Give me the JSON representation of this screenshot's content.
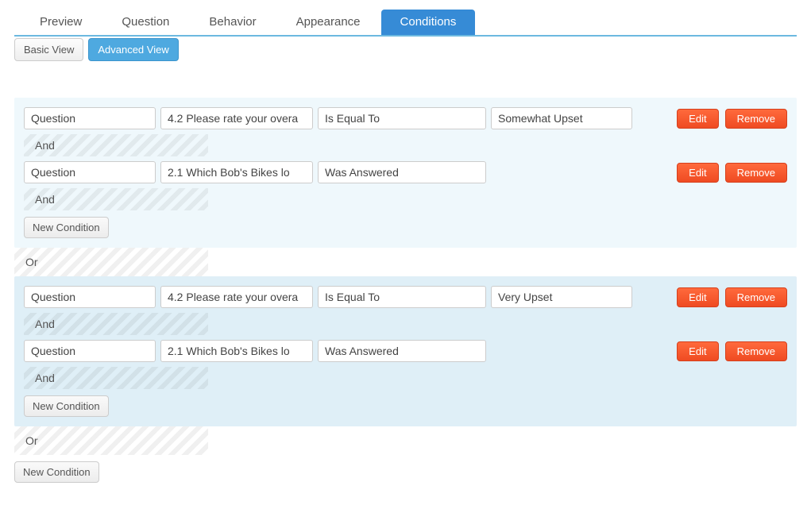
{
  "tabs": {
    "preview": "Preview",
    "question": "Question",
    "behavior": "Behavior",
    "appearance": "Appearance",
    "conditions": "Conditions"
  },
  "viewToggle": {
    "basic": "Basic View",
    "advanced": "Advanced View"
  },
  "labels": {
    "and": "And",
    "or": "Or",
    "edit": "Edit",
    "remove": "Remove",
    "newCondition": "New Condition"
  },
  "g1": {
    "r1": {
      "subject": "Question",
      "question": "4.2  Please rate your overa",
      "operator": "Is Equal To",
      "value": "Somewhat Upset"
    },
    "r2": {
      "subject": "Question",
      "question": "2.1  Which Bob's Bikes lo",
      "operator": "Was Answered"
    }
  },
  "g2": {
    "r1": {
      "subject": "Question",
      "question": "4.2  Please rate your overa",
      "operator": "Is Equal To",
      "value": "Very Upset"
    },
    "r2": {
      "subject": "Question",
      "question": "2.1  Which Bob's Bikes lo",
      "operator": "Was Answered"
    }
  }
}
